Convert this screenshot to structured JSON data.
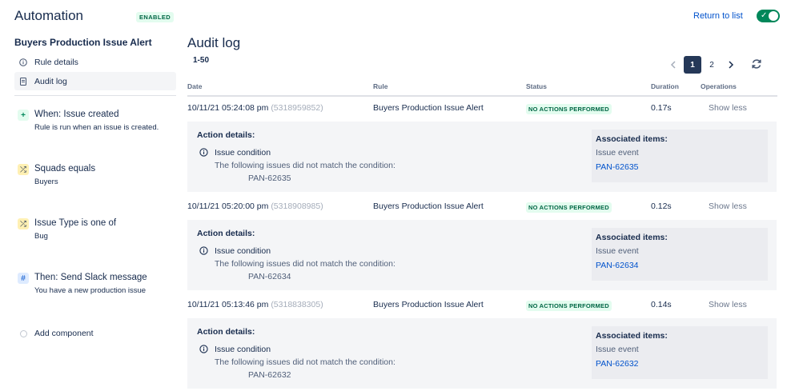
{
  "header": {
    "title": "Automation",
    "enabled_label": "ENABLED",
    "return_label": "Return to list",
    "toggle_on": true
  },
  "sidebar": {
    "rule_name": "Buyers Production Issue Alert",
    "nav": [
      {
        "label": "Rule details",
        "icon": "info-icon"
      },
      {
        "label": "Audit log",
        "icon": "document-icon",
        "active": true
      }
    ],
    "components": [
      {
        "icon": "plus-icon",
        "title": "When: Issue created",
        "subtitle": "Rule is run when an issue is created."
      },
      {
        "icon": "shuffle-icon",
        "title": "Squads equals",
        "subtitle": "Buyers"
      },
      {
        "icon": "shuffle-icon",
        "title": "Issue Type is one of",
        "subtitle": "Bug"
      },
      {
        "icon": "slack-icon",
        "title": "Then: Send Slack message",
        "subtitle": "You have a new production issue"
      }
    ],
    "add_component_label": "Add component"
  },
  "main": {
    "title": "Audit log",
    "range": "1-50",
    "pagination": {
      "pages": [
        "1",
        "2"
      ],
      "current": "1"
    },
    "columns": {
      "date": "Date",
      "rule": "Rule",
      "status": "Status",
      "duration": "Duration",
      "operations": "Operations"
    },
    "entries": [
      {
        "date": "10/11/21 05:24:08 pm",
        "id": "(5318959852)",
        "rule": "Buyers Production Issue Alert",
        "status": "NO ACTIONS PERFORMED",
        "duration": "0.17s",
        "operation": "Show less",
        "details": {
          "heading": "Action details:",
          "condition": "Issue condition",
          "message": "The following issues did not match the condition:",
          "issue": "PAN-62635",
          "assoc_heading": "Associated items:",
          "assoc_event": "Issue event",
          "assoc_link": "PAN-62635"
        }
      },
      {
        "date": "10/11/21 05:20:00 pm",
        "id": "(5318908985)",
        "rule": "Buyers Production Issue Alert",
        "status": "NO ACTIONS PERFORMED",
        "duration": "0.12s",
        "operation": "Show less",
        "details": {
          "heading": "Action details:",
          "condition": "Issue condition",
          "message": "The following issues did not match the condition:",
          "issue": "PAN-62634",
          "assoc_heading": "Associated items:",
          "assoc_event": "Issue event",
          "assoc_link": "PAN-62634"
        }
      },
      {
        "date": "10/11/21 05:13:46 pm",
        "id": "(5318838305)",
        "rule": "Buyers Production Issue Alert",
        "status": "NO ACTIONS PERFORMED",
        "duration": "0.14s",
        "operation": "Show less",
        "details": {
          "heading": "Action details:",
          "condition": "Issue condition",
          "message": "The following issues did not match the condition:",
          "issue": "PAN-62632",
          "assoc_heading": "Associated items:",
          "assoc_event": "Issue event",
          "assoc_link": "PAN-62632"
        }
      }
    ]
  },
  "colors": {
    "accent": "#0052cc",
    "success_bg": "#e3fcef",
    "success_text": "#006644",
    "toggle": "#00875a",
    "pager_current": "#253858"
  }
}
